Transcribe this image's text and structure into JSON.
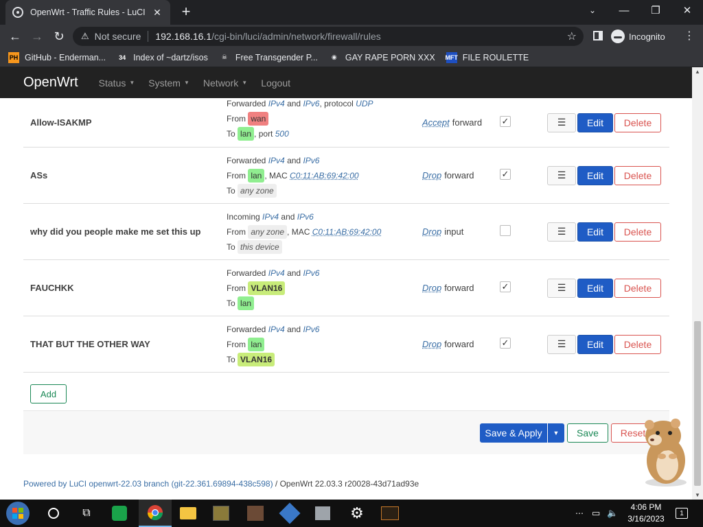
{
  "browser": {
    "tab_title": "OpenWrt - Traffic Rules - LuCI",
    "tab_close": "✕",
    "new_tab": "+",
    "minimize": "—",
    "restore": "❐",
    "close": "✕",
    "not_secure": "Not secure",
    "url_host": "192.168.16.1",
    "url_path": "/cgi-bin/luci/admin/network/firewall/rules",
    "incognito_label": "Incognito",
    "bookmarks": [
      {
        "icon_text": "PH",
        "icon_bg": "#f7971d",
        "icon_color": "#000",
        "label": "GitHub - Enderman..."
      },
      {
        "icon_text": "34",
        "icon_bg": "#35363a",
        "icon_color": "#fff",
        "label": "Index of ~dartz/isos"
      },
      {
        "icon_text": "☠",
        "icon_bg": "#35363a",
        "icon_color": "#fff",
        "label": "Free Transgender P..."
      },
      {
        "icon_text": "◉",
        "icon_bg": "#35363a",
        "icon_color": "#e8eaed",
        "label": "GAY RAPE PORN XXX"
      },
      {
        "icon_text": "MFT",
        "icon_bg": "#1e4fc1",
        "icon_color": "#fff",
        "label": "FILE ROULETTE"
      }
    ]
  },
  "luci": {
    "brand": "OpenWrt",
    "nav": [
      "Status",
      "System",
      "Network",
      "Logout"
    ],
    "nav_dropdowns": [
      true,
      true,
      true,
      false
    ],
    "rules": [
      {
        "name": "Allow-ISAKMP",
        "line1": {
          "prefix": "Forwarded",
          "p1": "IPv4",
          "and": "and",
          "p2": "IPv6",
          "extra": ", protocol",
          "extra_val": "UDP"
        },
        "from_label": "From",
        "from_badge": "wan",
        "from_class": "badge-wan",
        "from_extra": "",
        "from_extra_val": "",
        "to_label": "To",
        "to_badge": "lan",
        "to_class": "badge-lan",
        "to_extra": ", port",
        "to_extra_val": "500",
        "action": "Accept",
        "action_target": "forward",
        "enabled": true
      },
      {
        "name": "ASs",
        "line1": {
          "prefix": "Forwarded",
          "p1": "IPv4",
          "and": "and",
          "p2": "IPv6",
          "extra": "",
          "extra_val": ""
        },
        "from_label": "From",
        "from_badge": "lan",
        "from_class": "badge-lan",
        "from_extra": ", MAC",
        "from_extra_val": "C0:11:AB:69:42:00",
        "to_label": "To",
        "to_badge": "any zone",
        "to_class": "badge-any",
        "to_extra": "",
        "to_extra_val": "",
        "action": "Drop",
        "action_target": "forward",
        "enabled": true
      },
      {
        "name": "why did you people make me set this up",
        "line1": {
          "prefix": "Incoming",
          "p1": "IPv4",
          "and": "and",
          "p2": "IPv6",
          "extra": "",
          "extra_val": ""
        },
        "from_label": "From",
        "from_badge": "any zone",
        "from_class": "badge-any",
        "from_extra": ", MAC",
        "from_extra_val": "C0:11:AB:69:42:00",
        "to_label": "To",
        "to_badge": "this device",
        "to_class": "badge-any",
        "to_extra": "",
        "to_extra_val": "",
        "action": "Drop",
        "action_target": "input",
        "enabled": false
      },
      {
        "name": "FAUCHKK",
        "line1": {
          "prefix": "Forwarded",
          "p1": "IPv4",
          "and": "and",
          "p2": "IPv6",
          "extra": "",
          "extra_val": ""
        },
        "from_label": "From",
        "from_badge": "VLAN16",
        "from_class": "badge-vlan",
        "from_extra": "",
        "from_extra_val": "",
        "to_label": "To",
        "to_badge": "lan",
        "to_class": "badge-lan",
        "to_extra": "",
        "to_extra_val": "",
        "action": "Drop",
        "action_target": "forward",
        "enabled": true
      },
      {
        "name": "THAT BUT THE OTHER WAY",
        "line1": {
          "prefix": "Forwarded",
          "p1": "IPv4",
          "and": "and",
          "p2": "IPv6",
          "extra": "",
          "extra_val": ""
        },
        "from_label": "From",
        "from_badge": "lan",
        "from_class": "badge-lan",
        "from_extra": "",
        "from_extra_val": "",
        "to_label": "To",
        "to_badge": "VLAN16",
        "to_class": "badge-vlan",
        "to_extra": "",
        "to_extra_val": "",
        "action": "Drop",
        "action_target": "forward",
        "enabled": true
      }
    ],
    "row_buttons": {
      "drag": "☰",
      "edit": "Edit",
      "delete": "Delete"
    },
    "add_label": "Add",
    "save_apply_label": "Save & Apply",
    "save_apply_drop": "▼",
    "save_label": "Save",
    "reset_label": "Reset",
    "footer": {
      "link": "Powered by LuCI openwrt-22.03 branch (git-22.361.69894-438c598)",
      "rest": " / OpenWrt 22.03.3 r20028-43d71ad93e"
    }
  },
  "taskbar": {
    "time": "4:06 PM",
    "date": "3/16/2023",
    "notification_count": "1",
    "overflow": "⋯"
  },
  "colors": {
    "accent_blue": "#1f5cc5",
    "success_green": "#198754",
    "danger_red": "#d9534f",
    "header_dark": "#222222"
  }
}
